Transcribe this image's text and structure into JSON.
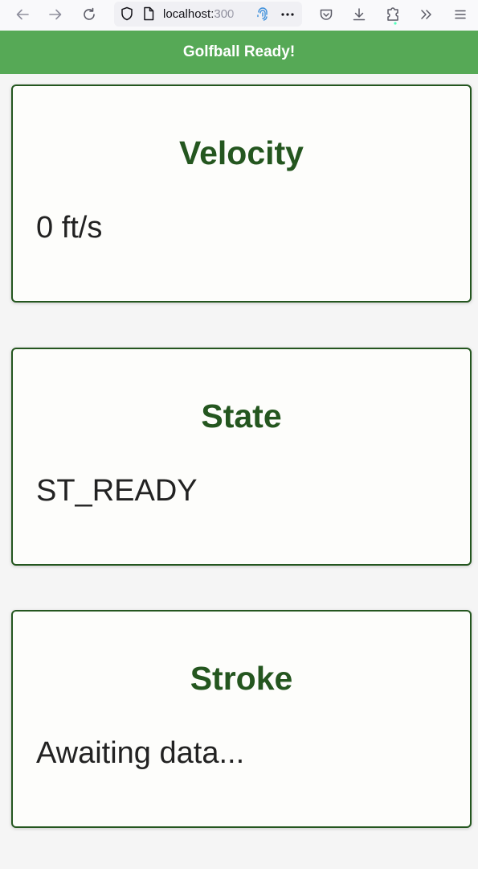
{
  "browser": {
    "url_host": "localhost:",
    "url_port": "300",
    "icons": [
      "back-arrow-icon",
      "forward-arrow-icon",
      "reload-icon",
      "shield-icon",
      "page-icon",
      "fingerprint-icon",
      "more-icon",
      "pocket-icon",
      "download-icon",
      "extensions-icon",
      "overflow-icon",
      "menu-icon"
    ]
  },
  "banner": {
    "text": "Golfball Ready!",
    "color": "#56a956"
  },
  "cards": [
    {
      "title": "Velocity",
      "value": "0 ft/s"
    },
    {
      "title": "State",
      "value": "ST_READY"
    },
    {
      "title": "Stroke",
      "value": "Awaiting data..."
    }
  ],
  "theme": {
    "accent": "#24561f",
    "card_bg": "#fdfdfb",
    "page_bg": "#f5f5f5"
  }
}
